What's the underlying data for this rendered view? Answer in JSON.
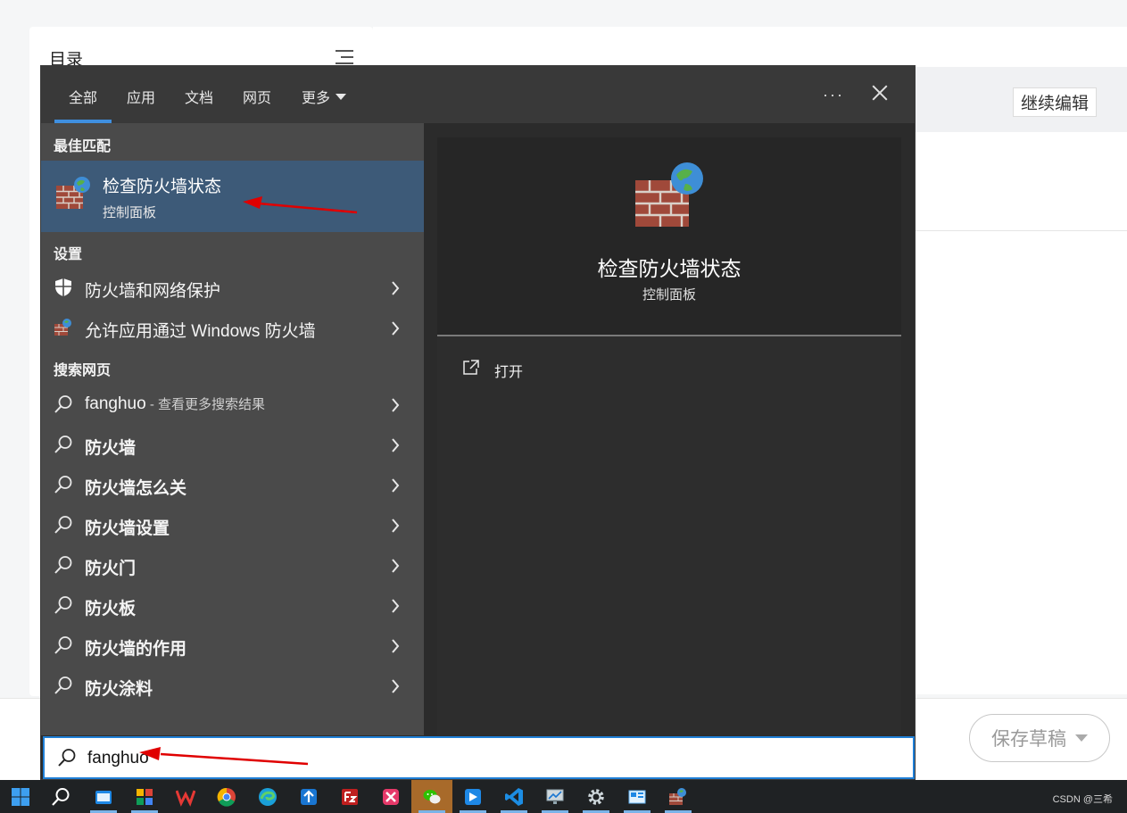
{
  "background_page": {
    "toc_title": "目录",
    "continue_edit_label": "继续编辑",
    "save_draft_label": "保存草稿"
  },
  "flyout": {
    "tabs": [
      "全部",
      "应用",
      "文档",
      "网页",
      "更多"
    ],
    "active_tab": "全部",
    "more_options_label": "···",
    "best_match": {
      "section_label": "最佳匹配",
      "title": "检查防火墙状态",
      "subtitle": "控制面板",
      "icon": "firewall-globe-icon"
    },
    "settings": {
      "section_label": "设置",
      "items": [
        {
          "label": "防火墙和网络保护",
          "icon": "shield-icon"
        },
        {
          "label": "允许应用通过 Windows 防火墙",
          "icon": "firewall-small-icon"
        }
      ]
    },
    "web": {
      "section_label": "搜索网页",
      "items": [
        {
          "label": "fanghuo",
          "suffix": " - 查看更多搜索结果",
          "bold": false
        },
        {
          "label": "防火墙",
          "bold": true
        },
        {
          "label": "防火墙怎么关",
          "bold": true
        },
        {
          "label": "防火墙设置",
          "bold": true
        },
        {
          "label": "防火门",
          "bold": true
        },
        {
          "label": "防火板",
          "bold": true
        },
        {
          "label": "防火墙的作用",
          "bold": true
        },
        {
          "label": "防火涂料",
          "bold": true
        }
      ]
    },
    "preview": {
      "title": "检查防火墙状态",
      "subtitle": "控制面板",
      "open_label": "打开"
    },
    "search": {
      "value": "fanghuo"
    }
  },
  "taskbar": {
    "items": [
      "start",
      "search",
      "file-explorer",
      "app-store",
      "wps",
      "chrome",
      "edge",
      "upload-tool",
      "filezilla",
      "xmind",
      "wechat",
      "feishu",
      "vscode",
      "remote-desktop",
      "settings",
      "control-panel",
      "firewall"
    ],
    "active_item": "wechat",
    "tray_text": "CSDN @三希"
  },
  "colors": {
    "flyout_bg": "#2b2b2b",
    "left_pane_bg": "#4a4a4a",
    "selected_bg": "#3d5a78",
    "accent": "#3f8fe0",
    "annotation_red": "#e00000"
  }
}
